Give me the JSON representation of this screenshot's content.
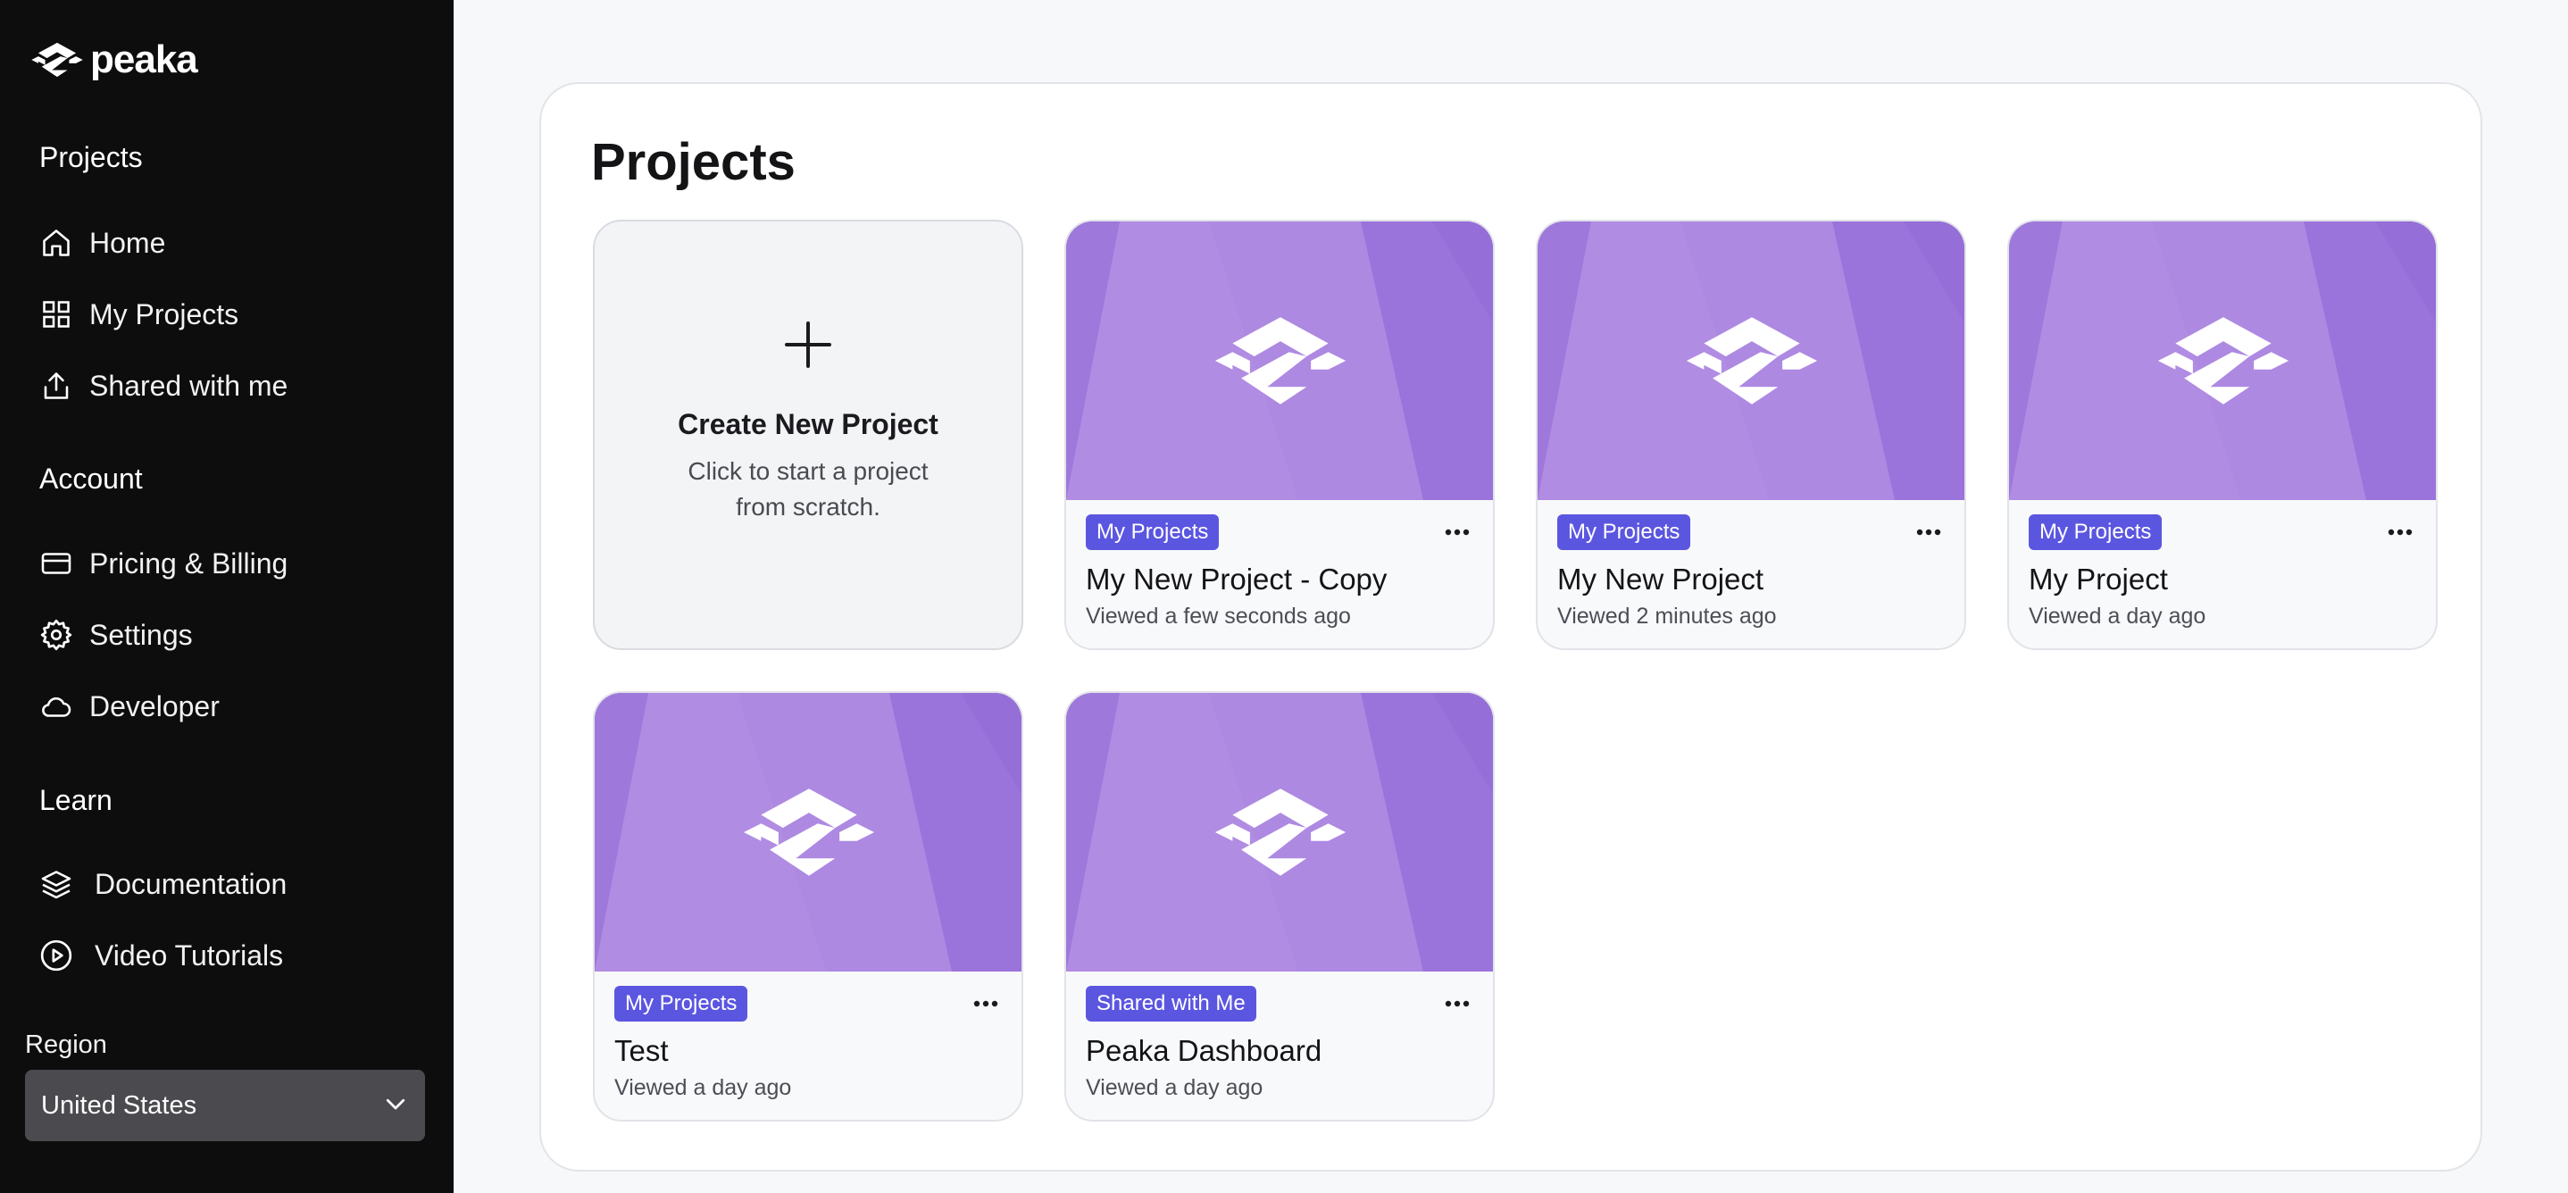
{
  "brand": {
    "name": "peaka",
    "logo_icon": "peaka-logo-icon"
  },
  "sidebar": {
    "sections": [
      {
        "title": "Projects"
      },
      {
        "title": "Account"
      },
      {
        "title": "Learn"
      }
    ],
    "items": [
      {
        "label": "Home",
        "icon": "home-icon"
      },
      {
        "label": "My Projects",
        "icon": "grid-icon"
      },
      {
        "label": "Shared with me",
        "icon": "share-icon"
      },
      {
        "label": "Pricing & Billing",
        "icon": "credit-card-icon"
      },
      {
        "label": "Settings",
        "icon": "gear-icon"
      },
      {
        "label": "Developer",
        "icon": "cloud-icon"
      },
      {
        "label": "Documentation",
        "icon": "layers-icon"
      },
      {
        "label": "Video Tutorials",
        "icon": "play-circle-icon"
      }
    ],
    "region": {
      "label": "Region",
      "value": "United States"
    }
  },
  "main": {
    "title": "Projects",
    "create_card": {
      "title": "Create New Project",
      "description": "Click to start a project from scratch."
    },
    "projects": [
      {
        "name": "My New Project - Copy",
        "badge": "My Projects",
        "viewed": "Viewed a few seconds ago"
      },
      {
        "name": "My New Project",
        "badge": "My Projects",
        "viewed": "Viewed 2 minutes ago"
      },
      {
        "name": "My Project",
        "badge": "My Projects",
        "viewed": "Viewed a day ago"
      },
      {
        "name": "Test",
        "badge": "My Projects",
        "viewed": "Viewed a day ago"
      },
      {
        "name": "Peaka Dashboard",
        "badge": "Shared with Me",
        "viewed": "Viewed a day ago"
      }
    ]
  },
  "colors": {
    "sidebar_bg": "#0d0d0d",
    "accent_badge": "#5b56e0",
    "thumbnail_purple": "#a884e0",
    "region_select_bg": "#4a4a4f"
  }
}
